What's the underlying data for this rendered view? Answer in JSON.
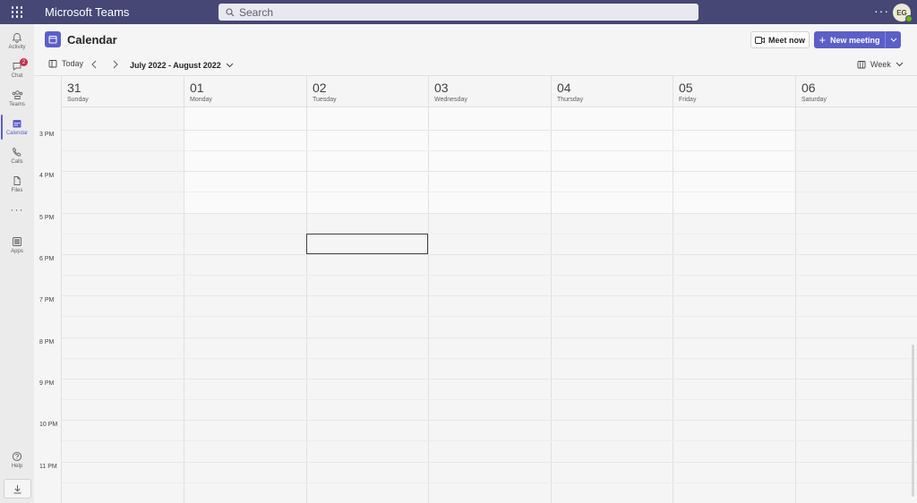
{
  "app": {
    "title": "Microsoft Teams"
  },
  "search": {
    "placeholder": "Search"
  },
  "user": {
    "initials": "EG"
  },
  "rail": {
    "items": [
      {
        "label": "Activity",
        "icon": "bell-icon"
      },
      {
        "label": "Chat",
        "icon": "chat-icon",
        "badge": "2"
      },
      {
        "label": "Teams",
        "icon": "teams-icon"
      },
      {
        "label": "Calendar",
        "icon": "calendar-icon",
        "active": true
      },
      {
        "label": "Calls",
        "icon": "phone-icon"
      },
      {
        "label": "Files",
        "icon": "file-icon"
      }
    ],
    "more": "···",
    "apps": "Apps",
    "help": "Help"
  },
  "header": {
    "title": "Calendar",
    "meet_now": "Meet now",
    "new_meeting": "New meeting"
  },
  "toolbar": {
    "today": "Today",
    "range": "July 2022 - August 2022",
    "view": "Week"
  },
  "calendar": {
    "days": [
      {
        "num": "31",
        "name": "Sunday"
      },
      {
        "num": "01",
        "name": "Monday"
      },
      {
        "num": "02",
        "name": "Tuesday"
      },
      {
        "num": "03",
        "name": "Wednesday"
      },
      {
        "num": "04",
        "name": "Thursday"
      },
      {
        "num": "05",
        "name": "Friday"
      },
      {
        "num": "06",
        "name": "Saturday"
      }
    ],
    "times": [
      "3 PM",
      "4 PM",
      "5 PM",
      "6 PM",
      "7 PM",
      "8 PM",
      "9 PM",
      "10 PM",
      "11 PM"
    ]
  },
  "colors": {
    "topbar": "#464775",
    "accent": "#5b5fc7",
    "badge": "#c4314b",
    "presence": "#6bb700"
  }
}
